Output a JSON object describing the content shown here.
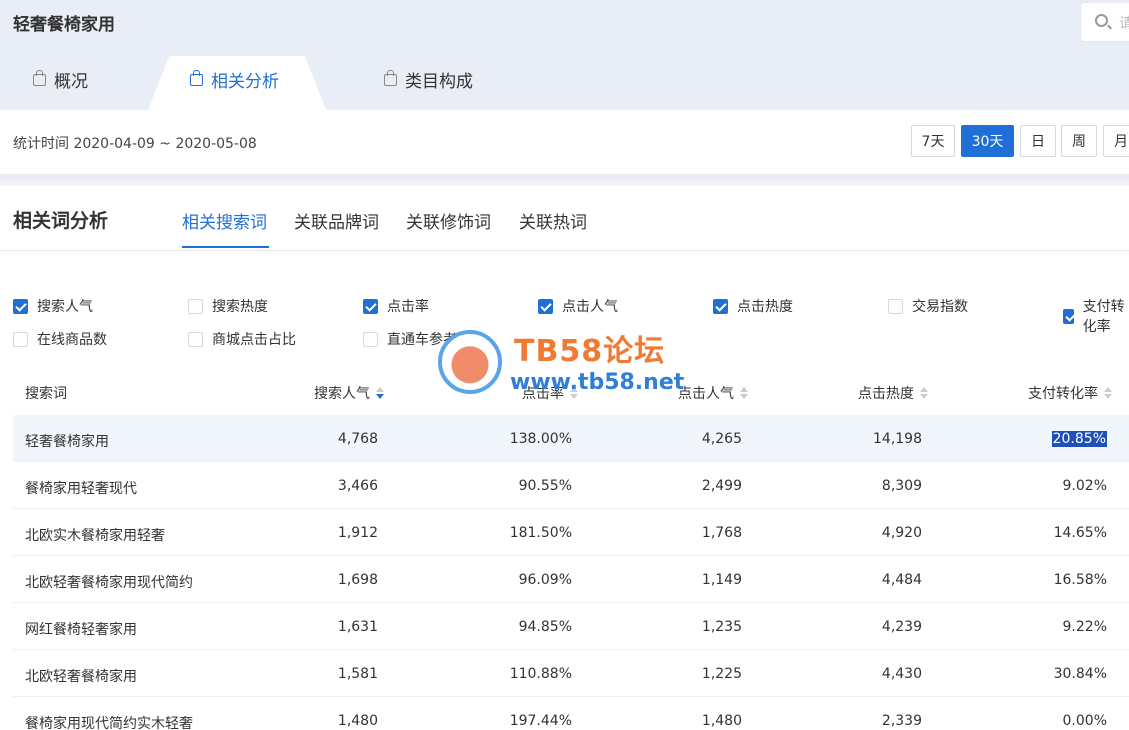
{
  "app": {
    "title": "轻奢餐椅家用",
    "search_placeholder": "请"
  },
  "main_tabs": [
    {
      "label": "概况",
      "icon": "bag-icon"
    },
    {
      "label": "相关分析",
      "icon": "bag-icon"
    },
    {
      "label": "类目构成",
      "icon": "bag-icon"
    }
  ],
  "stats": {
    "period_text": "统计时间 2020-04-09 ~ 2020-05-08",
    "ranges": [
      "7天",
      "30天",
      "日",
      "周",
      "月"
    ],
    "active_range": "30天"
  },
  "section": {
    "title": "相关词分析",
    "sub_tabs": [
      "相关搜索词",
      "关联品牌词",
      "关联修饰词",
      "关联热词"
    ],
    "active_sub_tab": "相关搜索词"
  },
  "metrics": [
    {
      "label": "搜索人气",
      "checked": true
    },
    {
      "label": "搜索热度",
      "checked": false
    },
    {
      "label": "点击率",
      "checked": true
    },
    {
      "label": "点击人气",
      "checked": true
    },
    {
      "label": "点击热度",
      "checked": true
    },
    {
      "label": "交易指数",
      "checked": false
    },
    {
      "label": "支付转化率",
      "checked": true
    },
    {
      "label": "在线商品数",
      "checked": false
    },
    {
      "label": "商城点击占比",
      "checked": false
    },
    {
      "label": "直通车参考价",
      "checked": false
    }
  ],
  "table": {
    "headers": [
      "搜索词",
      "搜索人气",
      "点击率",
      "点击人气",
      "点击热度",
      "支付转化率"
    ],
    "sort_column": "搜索人气",
    "sort_direction": "desc",
    "rows": [
      {
        "keyword": "轻奢餐椅家用",
        "search_pop": "4,768",
        "ctr": "138.00%",
        "click_pop": "4,265",
        "click_heat": "14,198",
        "pay_rate": "20.85%"
      },
      {
        "keyword": "餐椅家用轻奢现代",
        "search_pop": "3,466",
        "ctr": "90.55%",
        "click_pop": "2,499",
        "click_heat": "8,309",
        "pay_rate": "9.02%"
      },
      {
        "keyword": "北欧实木餐椅家用轻奢",
        "search_pop": "1,912",
        "ctr": "181.50%",
        "click_pop": "1,768",
        "click_heat": "4,920",
        "pay_rate": "14.65%"
      },
      {
        "keyword": "北欧轻奢餐椅家用现代简约",
        "search_pop": "1,698",
        "ctr": "96.09%",
        "click_pop": "1,149",
        "click_heat": "4,484",
        "pay_rate": "16.58%"
      },
      {
        "keyword": "网红餐椅轻奢家用",
        "search_pop": "1,631",
        "ctr": "94.85%",
        "click_pop": "1,235",
        "click_heat": "4,239",
        "pay_rate": "9.22%"
      },
      {
        "keyword": "北欧轻奢餐椅家用",
        "search_pop": "1,581",
        "ctr": "110.88%",
        "click_pop": "1,225",
        "click_heat": "4,430",
        "pay_rate": "30.84%"
      },
      {
        "keyword": "餐椅家用现代简约实木轻奢",
        "search_pop": "1,480",
        "ctr": "197.44%",
        "click_pop": "1,480",
        "click_heat": "2,339",
        "pay_rate": "0.00%"
      }
    ]
  },
  "watermark": {
    "title": "TB58论坛",
    "url": "www.tb58.net"
  },
  "colors": {
    "accent": "#1f6fd6",
    "header_bg": "#e9eef6",
    "row_highlight": "#f1f5fc"
  }
}
